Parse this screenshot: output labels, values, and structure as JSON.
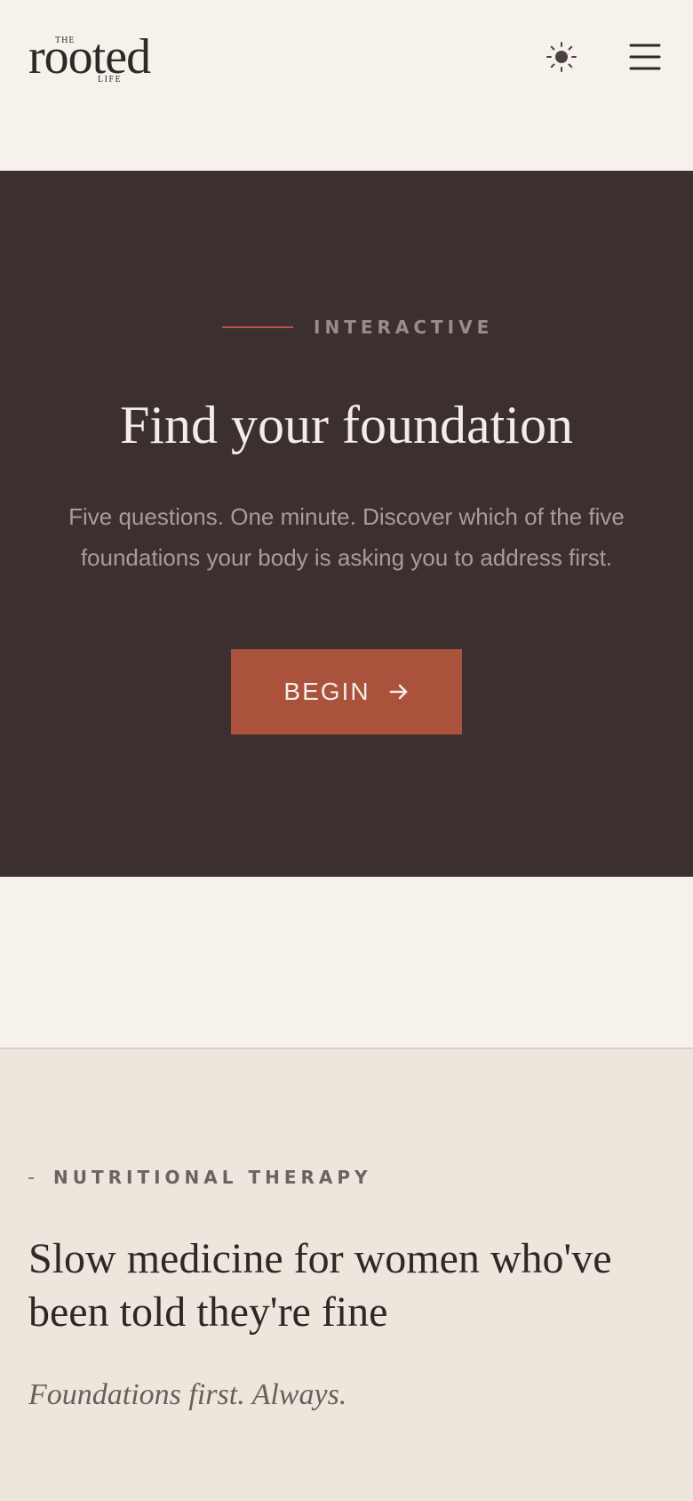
{
  "header": {
    "logo": {
      "the": "THE",
      "name": "rooted",
      "life": "LIFE"
    },
    "theme_icon": "sun-icon",
    "menu_icon": "hamburger-menu-icon"
  },
  "hero": {
    "eyebrow": "INTERACTIVE",
    "title": "Find your foundation",
    "description": "Five questions. One minute. Discover which of the five foundations your body is asking you to address first.",
    "button_label": "BEGIN",
    "button_icon": "arrow-right-icon"
  },
  "about": {
    "eyebrow": "NUTRITIONAL THERAPY",
    "title": "Slow medicine for women who've been told they're fine",
    "tagline": "Foundations first. Always."
  },
  "colors": {
    "background": "#f7f1eb",
    "hero_background": "#3b302f",
    "accent": "#aa523b",
    "about_background": "#ede6dc",
    "text_dark": "#2e2826"
  }
}
